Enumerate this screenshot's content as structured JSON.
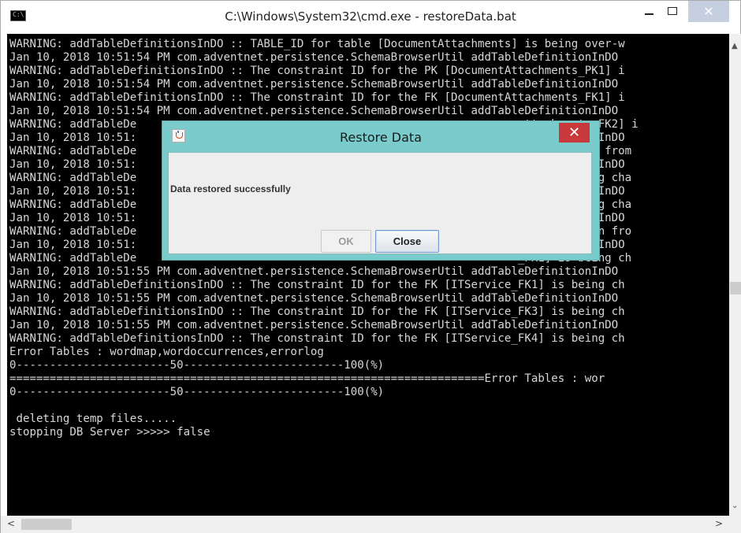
{
  "window": {
    "title": "C:\\Windows\\System32\\cmd.exe - restoreData.bat",
    "controls": {
      "minimize": "–",
      "maximize": "□",
      "close": "✕"
    }
  },
  "console": {
    "lines": [
      "WARNING: addTableDefinitionsInDO :: TABLE_ID for table [DocumentAttachments] is being over-w",
      "Jan 10, 2018 10:51:54 PM com.adventnet.persistence.SchemaBrowserUtil addTableDefinitionInDO",
      "WARNING: addTableDefinitionsInDO :: The constraint ID for the PK [DocumentAttachments_PK1] i",
      "Jan 10, 2018 10:51:54 PM com.adventnet.persistence.SchemaBrowserUtil addTableDefinitionInDO",
      "WARNING: addTableDefinitionsInDO :: The constraint ID for the FK [DocumentAttachments_FK1] i",
      "Jan 10, 2018 10:51:54 PM com.adventnet.persistence.SchemaBrowserUtil addTableDefinitionInDO",
      "WARNING: addTableDe                                                          ttachments_FK2] i",
      "Jan 10, 2018 10:51:                                                         leDefinitionInDO",
      "WARNING: addTableDe                                                         over-written from",
      "Jan 10, 2018 10:51:                                                         leDefinitionInDO",
      "WARNING: addTableDe                                                         PK1] is being cha",
      "Jan 10, 2018 10:51:                                                         leDefinitionInDO",
      "WARNING: addTableDe                                                         FK1] is being cha",
      "Jan 10, 2018 10:51:                                                         leDefinitionInDO",
      "WARNING: addTableDe                                                          over-written fro",
      "Jan 10, 2018 10:51:                                                         leDefinitionInDO",
      "WARNING: addTableDe                                                         _PK1] is being ch",
      "Jan 10, 2018 10:51:55 PM com.adventnet.persistence.SchemaBrowserUtil addTableDefinitionInDO",
      "WARNING: addTableDefinitionsInDO :: The constraint ID for the FK [ITService_FK1] is being ch",
      "Jan 10, 2018 10:51:55 PM com.adventnet.persistence.SchemaBrowserUtil addTableDefinitionInDO",
      "WARNING: addTableDefinitionsInDO :: The constraint ID for the FK [ITService_FK3] is being ch",
      "Jan 10, 2018 10:51:55 PM com.adventnet.persistence.SchemaBrowserUtil addTableDefinitionInDO",
      "WARNING: addTableDefinitionsInDO :: The constraint ID for the FK [ITService_FK4] is being ch",
      "Error Tables : wordmap,wordoccurrences,errorlog",
      "0-----------------------50------------------------100(%)",
      "=======================================================================Error Tables : wor",
      "0-----------------------50------------------------100(%)",
      "",
      " deleting temp files.....",
      "stopping DB Server >>>>> false"
    ]
  },
  "dialog": {
    "title": "Restore Data",
    "message": "Data restored successfully",
    "ok_label": "OK",
    "close_label": "Close",
    "close_glyph": "✕"
  },
  "scrollbars": {
    "up_arrow": "▲",
    "down_arrow": "⌄",
    "left_arrow": "<",
    "right_arrow": ">"
  },
  "colors": {
    "console_bg": "#000000",
    "console_text": "#d7d7d7",
    "dialog_frame": "#79cbcc",
    "dialog_close": "#c7393a"
  }
}
